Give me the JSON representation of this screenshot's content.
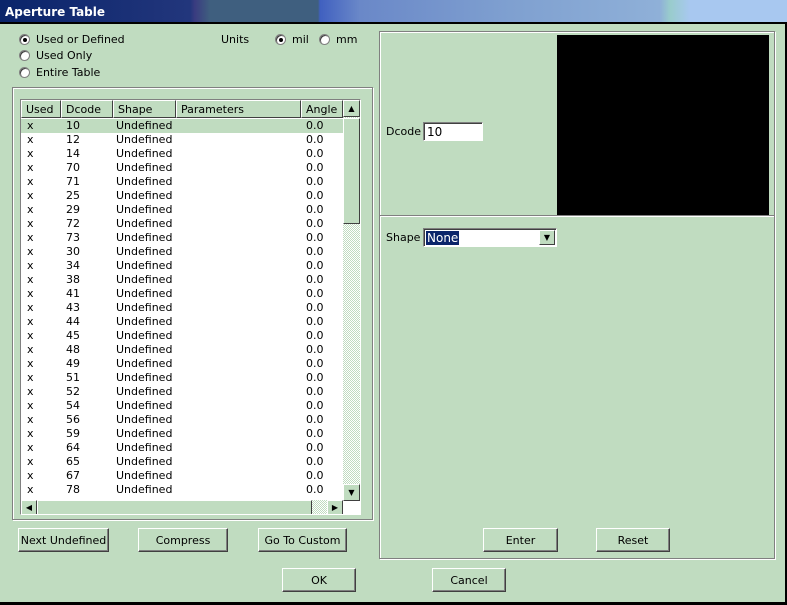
{
  "window": {
    "title": "Aperture Table"
  },
  "filter": {
    "options": [
      {
        "label": "Used or Defined",
        "selected": true
      },
      {
        "label": "Used Only",
        "selected": false
      },
      {
        "label": "Entire Table",
        "selected": false
      }
    ]
  },
  "units": {
    "label": "Units",
    "options": [
      {
        "label": "mil",
        "selected": true
      },
      {
        "label": "mm",
        "selected": false
      }
    ]
  },
  "table": {
    "columns": [
      "Used",
      "Dcode",
      "Shape",
      "Parameters",
      "Angle"
    ],
    "selected_index": 0,
    "rows": [
      [
        "x",
        "10",
        "Undefined",
        "",
        "0.0"
      ],
      [
        "x",
        "12",
        "Undefined",
        "",
        "0.0"
      ],
      [
        "x",
        "14",
        "Undefined",
        "",
        "0.0"
      ],
      [
        "x",
        "70",
        "Undefined",
        "",
        "0.0"
      ],
      [
        "x",
        "71",
        "Undefined",
        "",
        "0.0"
      ],
      [
        "x",
        "25",
        "Undefined",
        "",
        "0.0"
      ],
      [
        "x",
        "29",
        "Undefined",
        "",
        "0.0"
      ],
      [
        "x",
        "72",
        "Undefined",
        "",
        "0.0"
      ],
      [
        "x",
        "73",
        "Undefined",
        "",
        "0.0"
      ],
      [
        "x",
        "30",
        "Undefined",
        "",
        "0.0"
      ],
      [
        "x",
        "34",
        "Undefined",
        "",
        "0.0"
      ],
      [
        "x",
        "38",
        "Undefined",
        "",
        "0.0"
      ],
      [
        "x",
        "41",
        "Undefined",
        "",
        "0.0"
      ],
      [
        "x",
        "43",
        "Undefined",
        "",
        "0.0"
      ],
      [
        "x",
        "44",
        "Undefined",
        "",
        "0.0"
      ],
      [
        "x",
        "45",
        "Undefined",
        "",
        "0.0"
      ],
      [
        "x",
        "48",
        "Undefined",
        "",
        "0.0"
      ],
      [
        "x",
        "49",
        "Undefined",
        "",
        "0.0"
      ],
      [
        "x",
        "51",
        "Undefined",
        "",
        "0.0"
      ],
      [
        "x",
        "52",
        "Undefined",
        "",
        "0.0"
      ],
      [
        "x",
        "54",
        "Undefined",
        "",
        "0.0"
      ],
      [
        "x",
        "56",
        "Undefined",
        "",
        "0.0"
      ],
      [
        "x",
        "59",
        "Undefined",
        "",
        "0.0"
      ],
      [
        "x",
        "64",
        "Undefined",
        "",
        "0.0"
      ],
      [
        "x",
        "65",
        "Undefined",
        "",
        "0.0"
      ],
      [
        "x",
        "67",
        "Undefined",
        "",
        "0.0"
      ],
      [
        "x",
        "78",
        "Undefined",
        "",
        "0.0"
      ]
    ]
  },
  "left_buttons": {
    "next_undefined": "Next Undefined",
    "compress": "Compress",
    "go_to_custom": "Go To Custom"
  },
  "editor": {
    "dcode_label": "Dcode",
    "dcode_value": "10",
    "shape_label": "Shape",
    "shape_value": "None",
    "enter": "Enter",
    "reset": "Reset"
  },
  "dialog_buttons": {
    "ok": "OK",
    "cancel": "Cancel"
  },
  "colors": {
    "background": "#c0dcc0",
    "preview": "#000000",
    "selection": "#0a246a"
  }
}
